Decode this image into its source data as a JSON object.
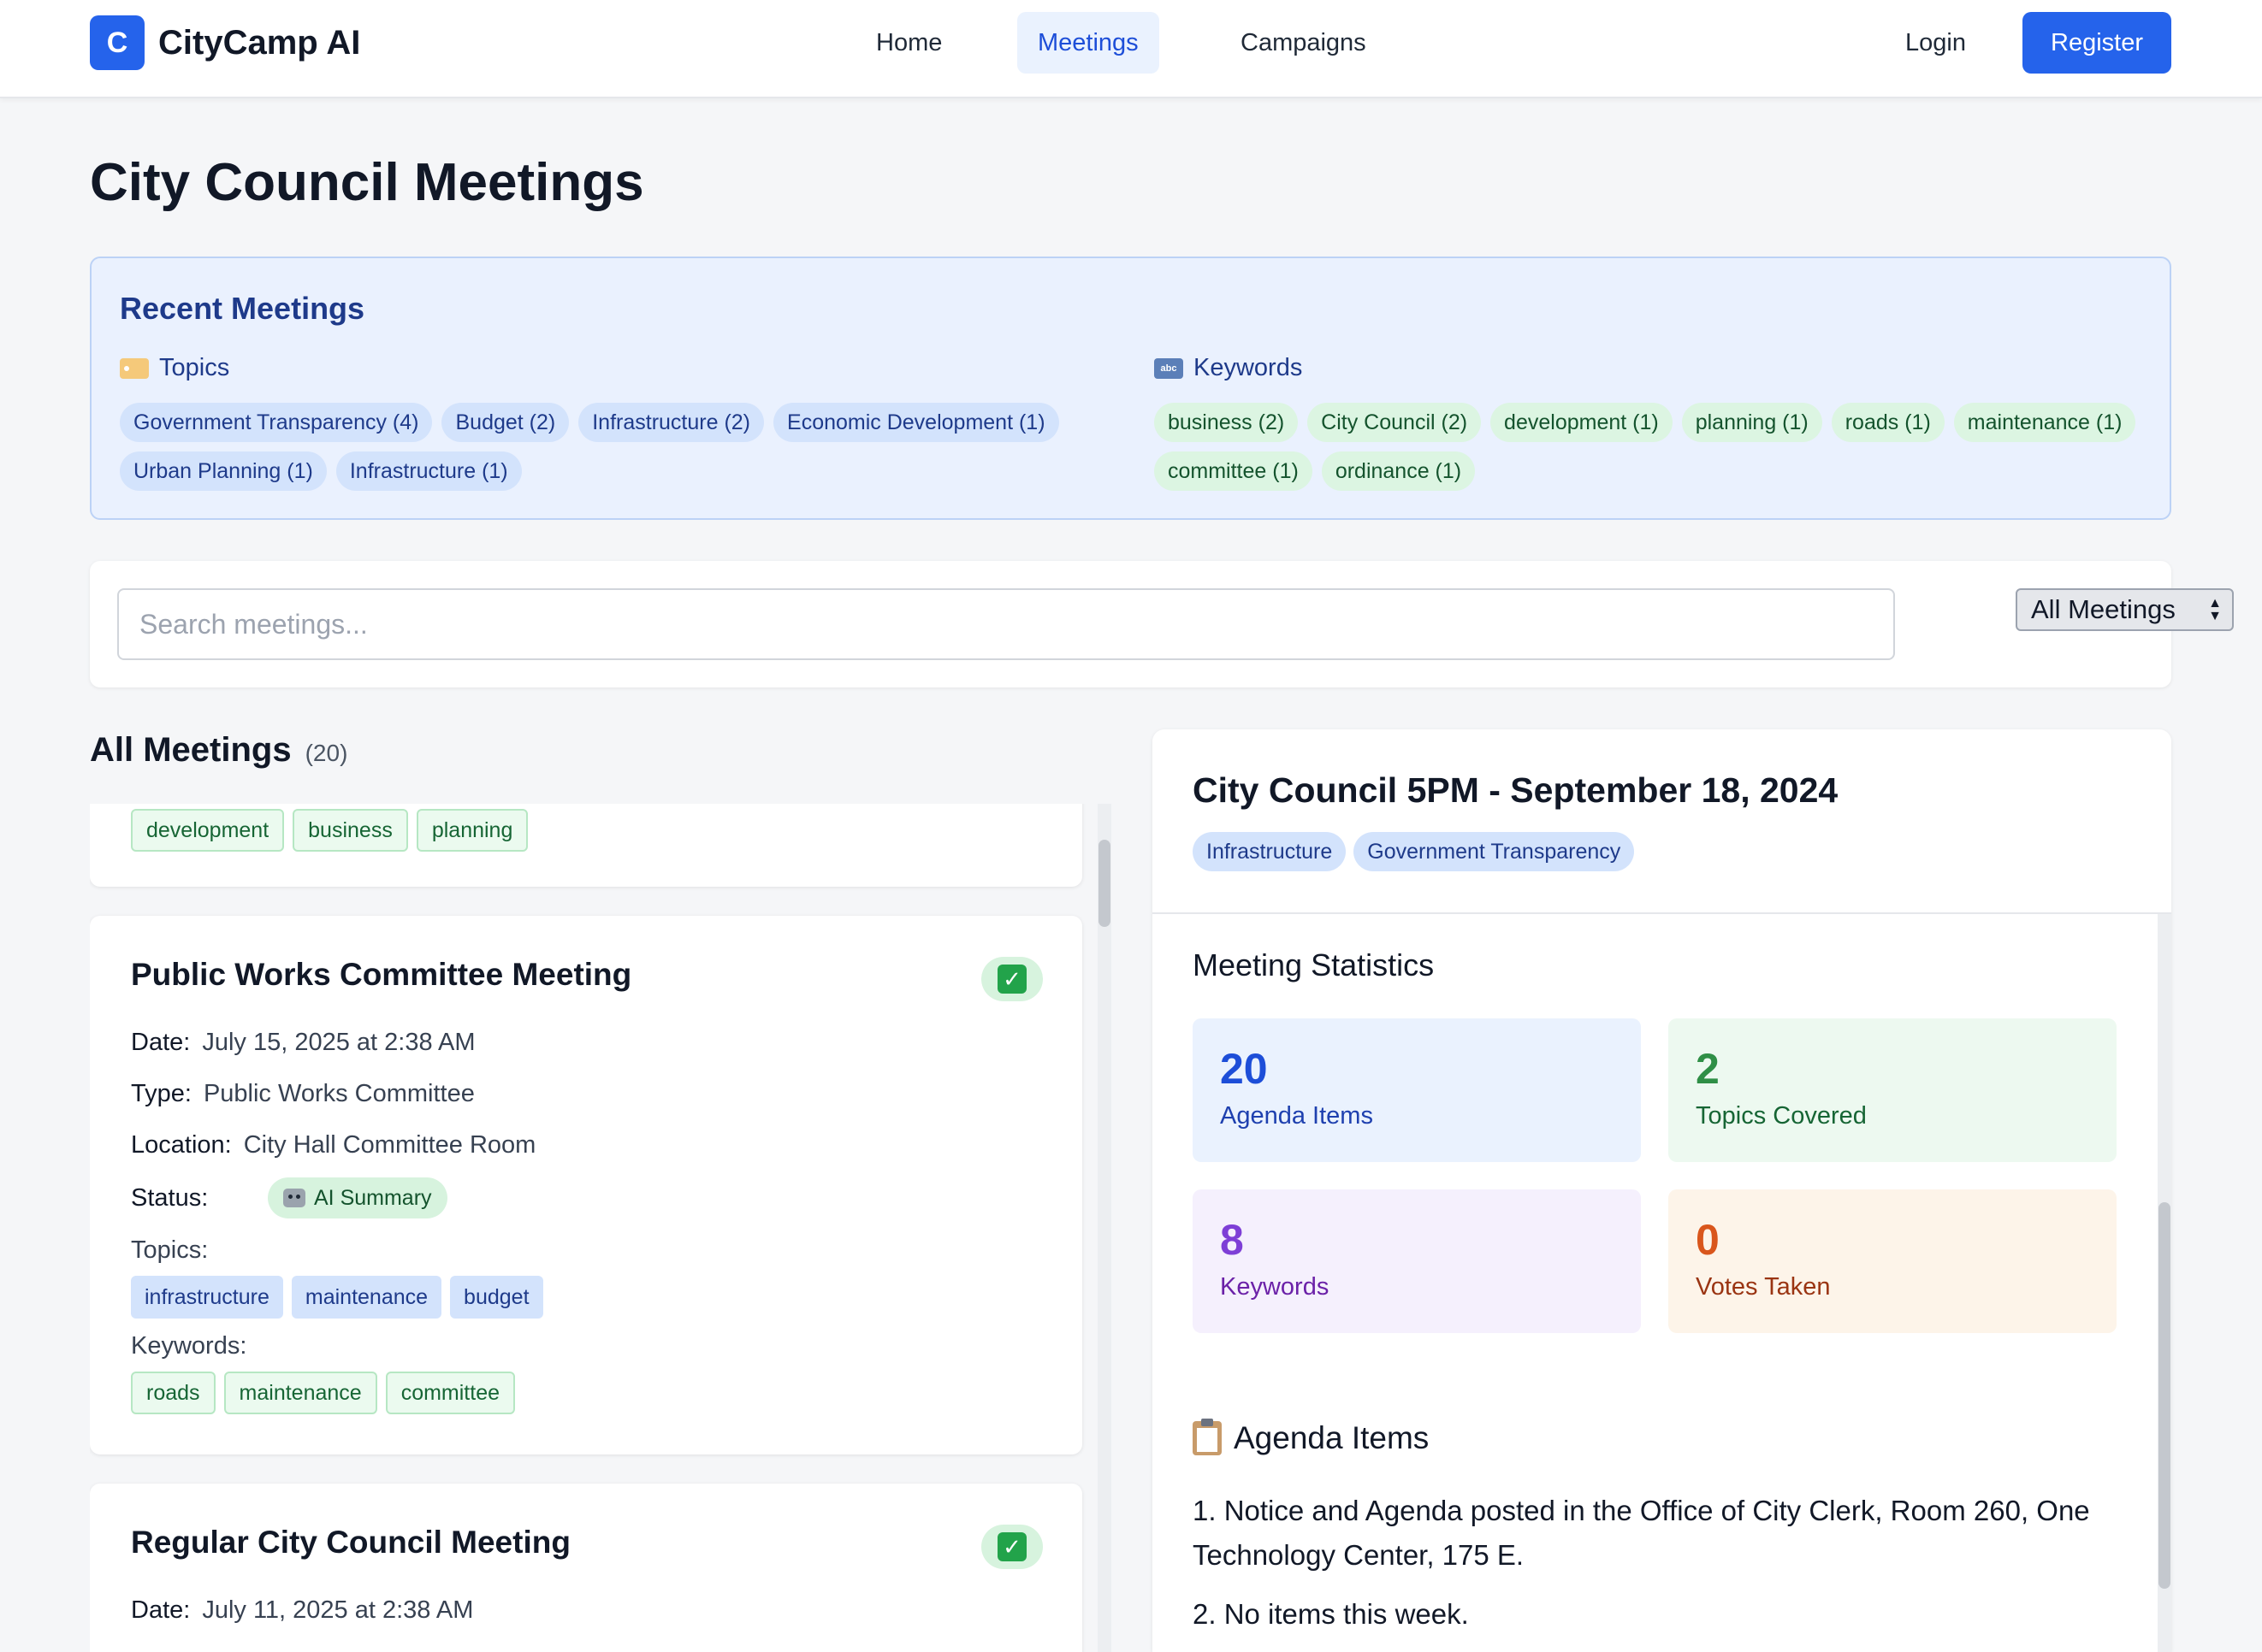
{
  "app": {
    "logo_letter": "C",
    "name": "CityCamp AI"
  },
  "nav": {
    "home": "Home",
    "meetings": "Meetings",
    "campaigns": "Campaigns",
    "login": "Login",
    "register": "Register"
  },
  "page": {
    "title": "City Council Meetings"
  },
  "recent": {
    "title": "Recent Meetings",
    "topics_label": "Topics",
    "keywords_label": "Keywords",
    "topics": [
      "Government Transparency (4)",
      "Budget (2)",
      "Infrastructure (2)",
      "Economic Development (1)",
      "Urban Planning (1)",
      "Infrastructure (1)"
    ],
    "keywords": [
      "business (2)",
      "City Council (2)",
      "development (1)",
      "planning (1)",
      "roads (1)",
      "maintenance (1)",
      "committee (1)",
      "ordinance (1)"
    ]
  },
  "search": {
    "placeholder": "Search meetings...",
    "filter_value": "All Meetings"
  },
  "list": {
    "title": "All Meetings",
    "count": "(20)",
    "partial_keywords": [
      "development",
      "business",
      "planning"
    ],
    "cards": [
      {
        "title": "Public Works Committee Meeting",
        "date_label": "Date:",
        "date": "July 15, 2025 at 2:38 AM",
        "type_label": "Type:",
        "type": "Public Works Committee",
        "location_label": "Location:",
        "location": "City Hall Committee Room",
        "status_label": "Status:",
        "status": "AI Summary",
        "topics_label": "Topics:",
        "topics": [
          "infrastructure",
          "maintenance",
          "budget"
        ],
        "keywords_label": "Keywords:",
        "keywords": [
          "roads",
          "maintenance",
          "committee"
        ]
      },
      {
        "title": "Regular City Council Meeting",
        "date_label": "Date:",
        "date": "July 11, 2025 at 2:38 AM"
      }
    ]
  },
  "detail": {
    "title": "City Council 5PM - September 18, 2024",
    "tags": [
      "Infrastructure",
      "Government Transparency"
    ],
    "stats_title": "Meeting Statistics",
    "stats": [
      {
        "value": "20",
        "label": "Agenda Items"
      },
      {
        "value": "2",
        "label": "Topics Covered"
      },
      {
        "value": "8",
        "label": "Keywords"
      },
      {
        "value": "0",
        "label": "Votes Taken"
      }
    ],
    "agenda_title": "Agenda Items",
    "agenda": [
      "1. Notice and Agenda posted in the Office of City Clerk, Room 260, One Technology Center, 175 E.",
      "2. No items this week."
    ]
  },
  "colors": {
    "accent": "#2563eb",
    "topic_chip": "#d3e3fc",
    "keyword_chip": "#dcf5e2"
  }
}
